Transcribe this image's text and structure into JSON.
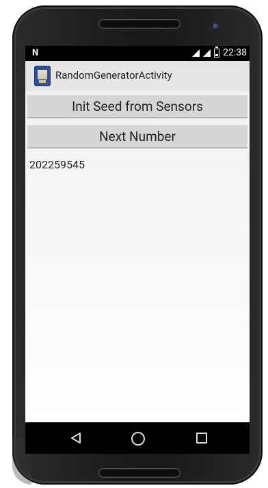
{
  "status_bar": {
    "notification_icon": "N",
    "time": "22:38",
    "icons": [
      "signal-icon",
      "signal-icon",
      "battery-icon"
    ]
  },
  "action_bar": {
    "title": "RandomGeneratorActivity",
    "icon": "app-icon"
  },
  "main": {
    "init_seed_label": "Init Seed from Sensors",
    "next_number_label": "Next Number",
    "result": "202259545"
  },
  "nav_bar": {
    "back": "back-icon",
    "home": "home-icon",
    "recents": "recents-icon"
  },
  "colors": {
    "action_bar_bg": "#e6e6e6",
    "button_bg": "#d6d6d6",
    "status_bar_bg": "#000000",
    "phone_body": "#1c1c1c"
  }
}
